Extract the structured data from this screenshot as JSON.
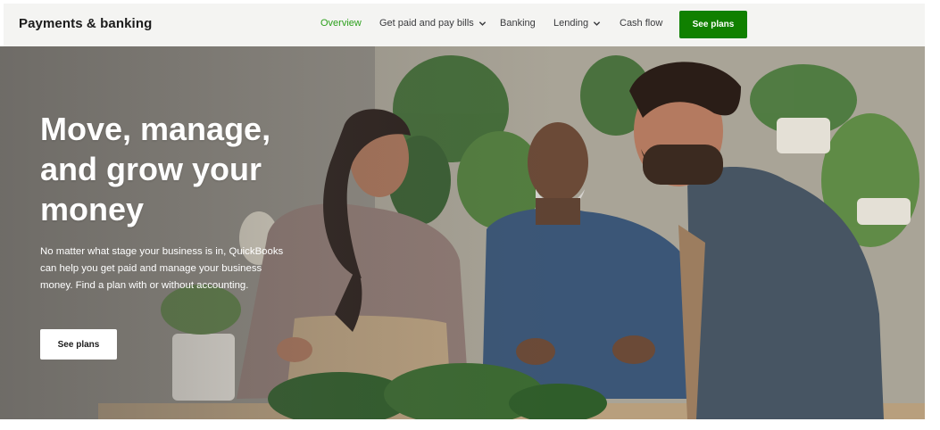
{
  "header": {
    "brand": "Payments & banking",
    "nav": [
      {
        "label": "Overview",
        "active": true,
        "has_dropdown": false
      },
      {
        "label": "Get paid and pay bills",
        "active": false,
        "has_dropdown": true
      },
      {
        "label": "Banking",
        "active": false,
        "has_dropdown": false
      },
      {
        "label": "Lending",
        "active": false,
        "has_dropdown": true
      },
      {
        "label": "Cash flow",
        "active": false,
        "has_dropdown": false
      }
    ],
    "cta_label": "See plans"
  },
  "hero": {
    "title": "Move, manage, and grow your money",
    "text": "No matter what stage your business is in, QuickBooks can help you get paid and manage your business money. Find a plan with or without accounting.",
    "button_label": "See plans"
  },
  "colors": {
    "accent_green": "#2ca01c",
    "cta_green": "#108000",
    "nav_bg": "#f4f4f2",
    "text_dark": "#1b1b1b"
  },
  "icons": {
    "dropdown": "chevron-down-icon"
  }
}
